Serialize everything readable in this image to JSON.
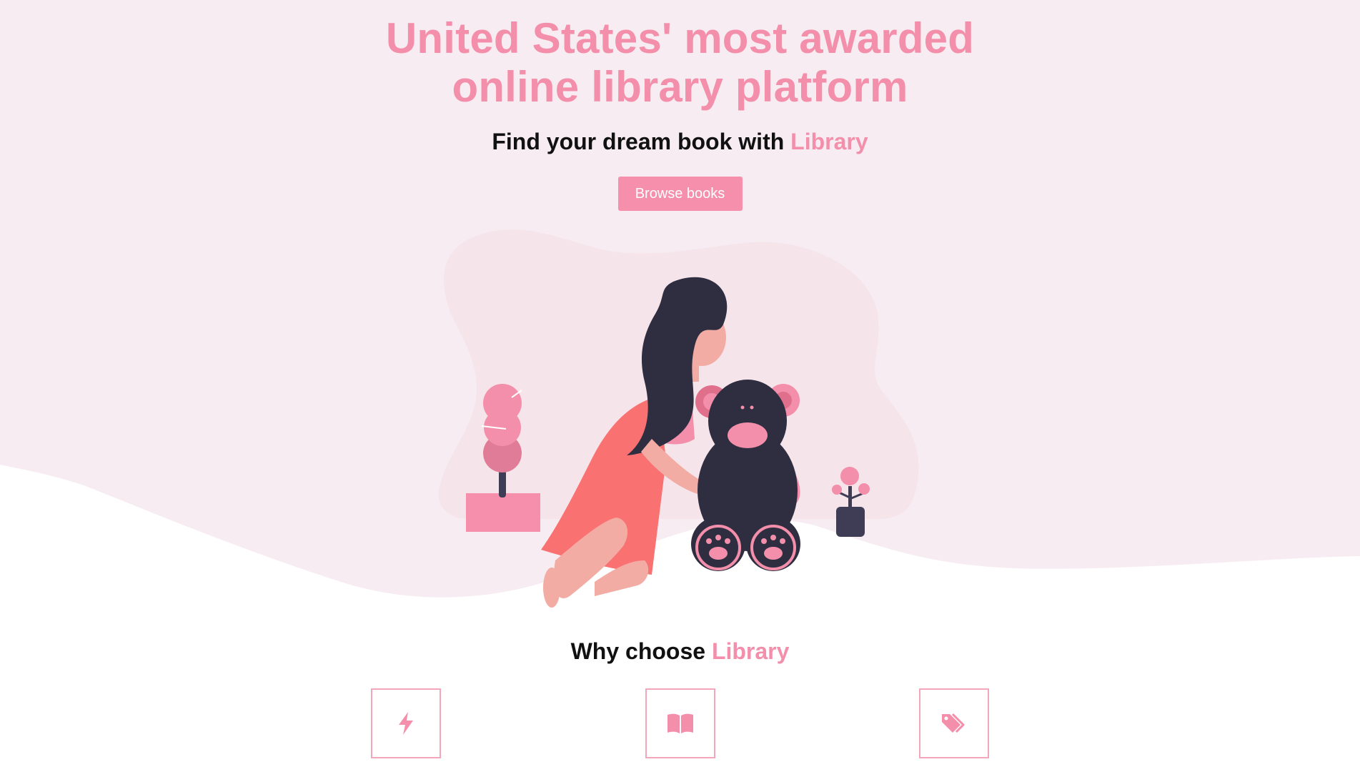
{
  "hero": {
    "title_line1": "United States' most awarded",
    "title_line2": "online library platform",
    "subtitle_prefix": "Find your dream book with ",
    "subtitle_brand": "Library",
    "browse_button": "Browse books"
  },
  "why": {
    "heading_prefix": "Why choose ",
    "heading_brand": "Library"
  },
  "features": [
    {
      "icon": "lightning-icon"
    },
    {
      "icon": "open-book-icon"
    },
    {
      "icon": "tags-icon"
    }
  ],
  "colors": {
    "accent": "#f48fab",
    "hero_background": "#f7ecf1",
    "text_dark": "#111111",
    "button_text": "#ffffff"
  }
}
